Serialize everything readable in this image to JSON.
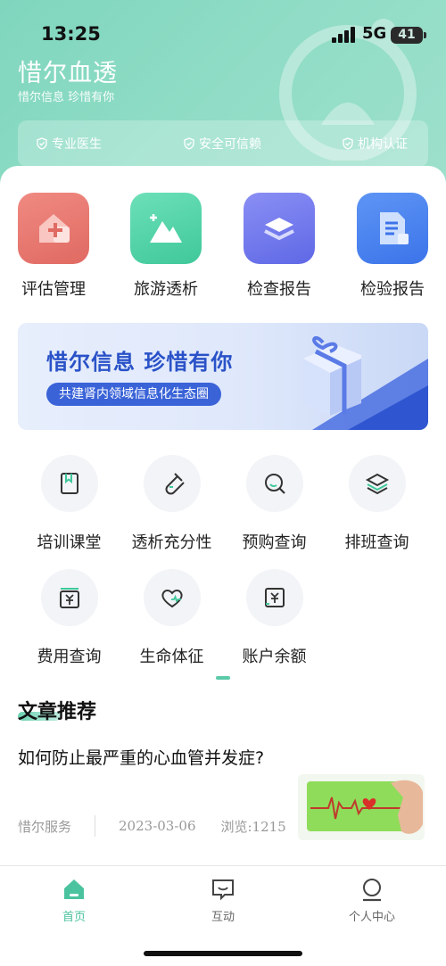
{
  "status_bar": {
    "time": "13:25",
    "network": "5G",
    "battery": "41"
  },
  "header": {
    "title": "惜尔血透",
    "subtitle": "惜尔信息 珍惜有你",
    "badges": [
      {
        "icon": "shield-check-icon",
        "label": "专业医生"
      },
      {
        "icon": "shield-check-icon",
        "label": "安全可信赖"
      },
      {
        "icon": "shield-check-icon",
        "label": "机构认证"
      }
    ]
  },
  "quick_entries": [
    {
      "label": "评估管理",
      "icon": "house-heart-icon",
      "color": "#e8736c"
    },
    {
      "label": "旅游透析",
      "icon": "mountain-icon",
      "color": "#4fd1a5"
    },
    {
      "label": "检查报告",
      "icon": "layers-icon",
      "color": "#6b74ea"
    },
    {
      "label": "检验报告",
      "icon": "document-icon",
      "color": "#4a82ef"
    }
  ],
  "banner": {
    "title": "惜尔信息 珍惜有你",
    "tagline": "共建肾内领域信息化生态圈"
  },
  "services": [
    {
      "label": "培训课堂",
      "icon": "bookmark-book-icon"
    },
    {
      "label": "透析充分性",
      "icon": "test-tube-icon"
    },
    {
      "label": "预购查询",
      "icon": "search-icon"
    },
    {
      "label": "排班查询",
      "icon": "stack-icon"
    },
    {
      "label": "费用查询",
      "icon": "yen-box-icon"
    },
    {
      "label": "生命体征",
      "icon": "heart-pulse-icon"
    },
    {
      "label": "账户余额",
      "icon": "yen-square-icon"
    }
  ],
  "articles": {
    "section_title": "文章推荐",
    "items": [
      {
        "title": "如何防止最严重的心血管并发症?",
        "source": "惜尔服务",
        "date": "2023-03-06",
        "views": "浏览:1215"
      }
    ]
  },
  "tabbar": {
    "active": "home",
    "items": [
      {
        "label": "首页",
        "icon": "home-icon"
      },
      {
        "label": "互动",
        "icon": "chat-icon"
      },
      {
        "label": "个人中心",
        "icon": "user-icon"
      }
    ]
  },
  "colors": {
    "accent": "#4cc39f",
    "header_bg": "#8fdcc5"
  }
}
